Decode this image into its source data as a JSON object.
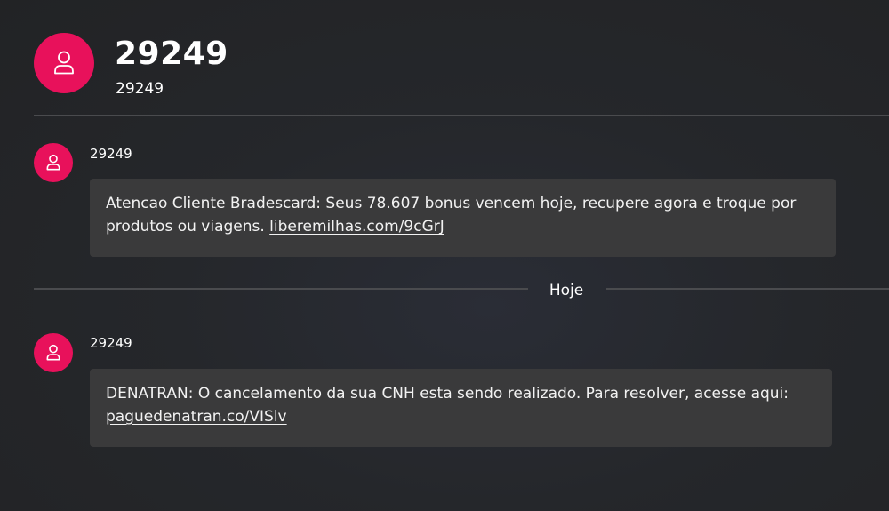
{
  "header": {
    "avatar_icon": "person-icon",
    "contact_name": "29249",
    "contact_number": "29249"
  },
  "date_separator": "Hoje",
  "messages": [
    {
      "sender": "29249",
      "avatar_icon": "person-icon",
      "text": "Atencao Cliente Bradescard: Seus 78.607 bonus vencem hoje, recupere agora e troque por produtos ou viagens. ",
      "link": "liberemilhas.com/9cGrJ"
    },
    {
      "sender": "29249",
      "avatar_icon": "person-icon",
      "text": "DENATRAN: O cancelamento da sua CNH esta sendo realizado. Para resolver, acesse aqui: ",
      "link": "paguedenatran.co/VISlv"
    }
  ],
  "colors": {
    "accent": "#e8115b",
    "bubble": "#3a3a3b",
    "background": "#25272b",
    "divider": "#4a4b4e"
  }
}
